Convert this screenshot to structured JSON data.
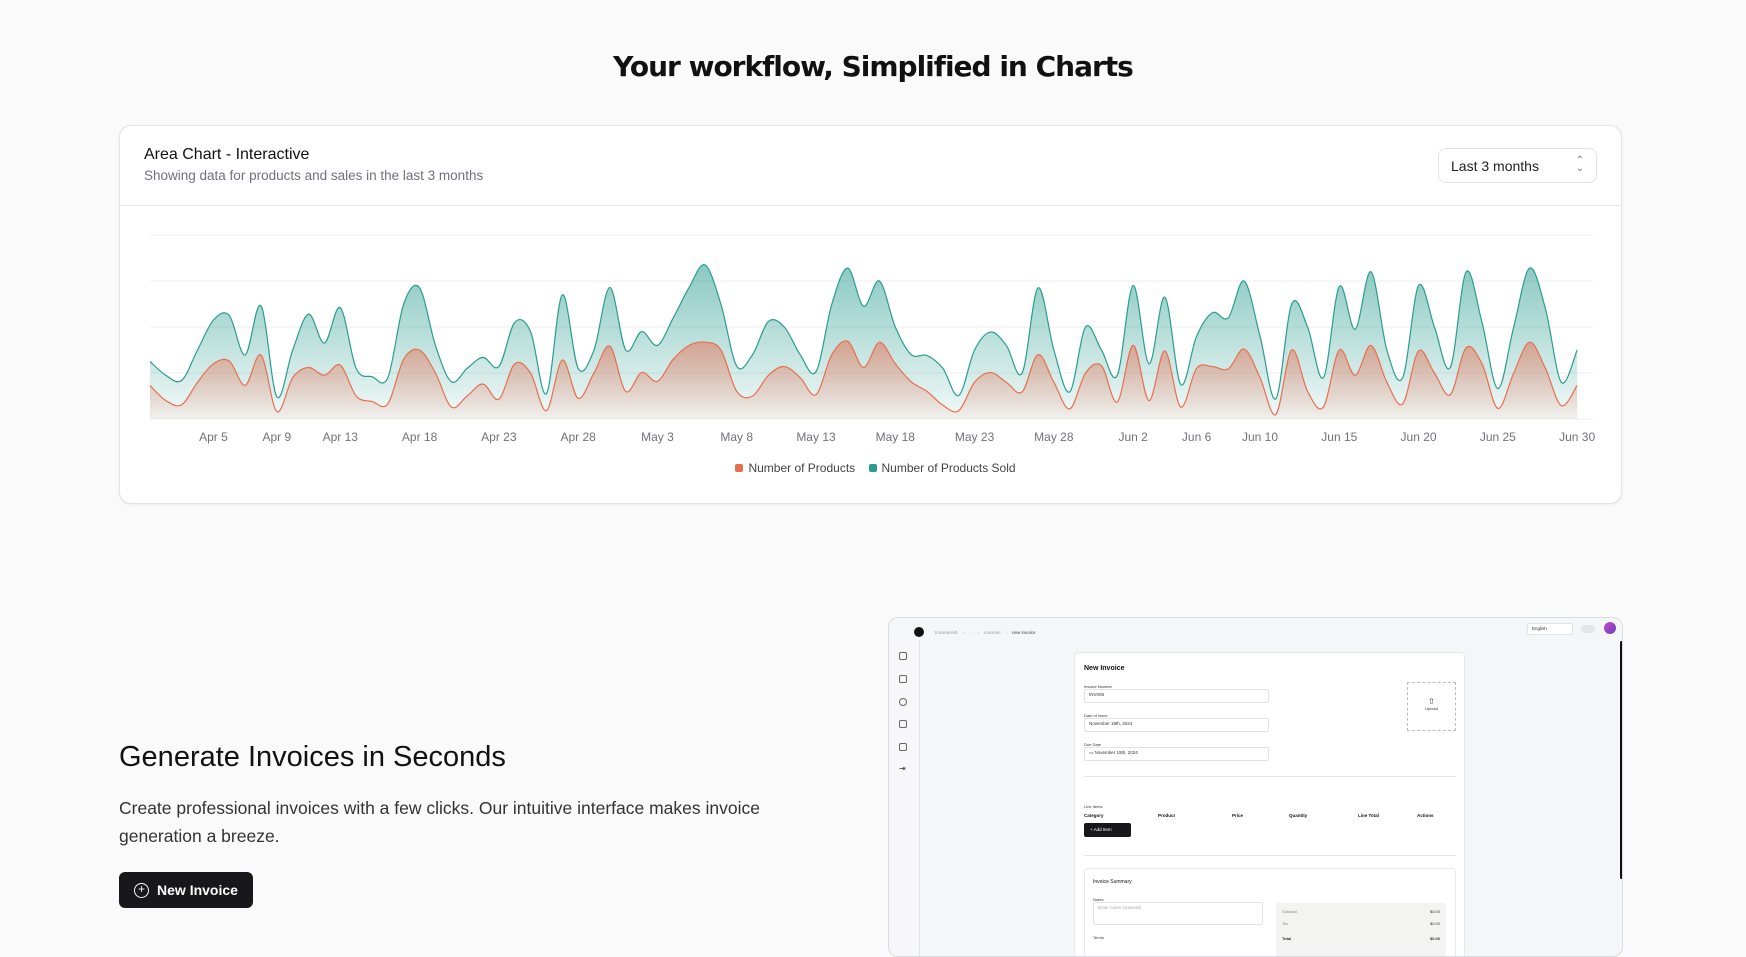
{
  "page": {
    "title": "Your workflow, Simplified in Charts"
  },
  "chart_card": {
    "title": "Area Chart - Interactive",
    "subtitle": "Showing data for products and sales in the last 3 months",
    "range_select": "Last 3 months"
  },
  "chart_data": {
    "type": "area",
    "title": "Area Chart - Interactive",
    "x_range": [
      "Apr 1",
      "Jun 30"
    ],
    "x_ticks": [
      {
        "i": 4,
        "label": "Apr 5"
      },
      {
        "i": 8,
        "label": "Apr 9"
      },
      {
        "i": 12,
        "label": "Apr 13"
      },
      {
        "i": 17,
        "label": "Apr 18"
      },
      {
        "i": 22,
        "label": "Apr 23"
      },
      {
        "i": 27,
        "label": "Apr 28"
      },
      {
        "i": 32,
        "label": "May 3"
      },
      {
        "i": 37,
        "label": "May 8"
      },
      {
        "i": 42,
        "label": "May 13"
      },
      {
        "i": 47,
        "label": "May 18"
      },
      {
        "i": 52,
        "label": "May 23"
      },
      {
        "i": 57,
        "label": "May 28"
      },
      {
        "i": 62,
        "label": "Jun 2"
      },
      {
        "i": 66,
        "label": "Jun 6"
      },
      {
        "i": 70,
        "label": "Jun 10"
      },
      {
        "i": 75,
        "label": "Jun 15"
      },
      {
        "i": 80,
        "label": "Jun 20"
      },
      {
        "i": 85,
        "label": "Jun 25"
      },
      {
        "i": 90,
        "label": "Jun 30"
      }
    ],
    "ylim": [
      0,
      400
    ],
    "grid": true,
    "legend": "bottom-center",
    "series": [
      {
        "name": "Number of Products Sold",
        "color": "#2a9d8f",
        "values": [
          125,
          95,
          84,
          150,
          215,
          225,
          139,
          246,
          48,
          150,
          228,
          165,
          242,
          110,
          92,
          90,
          250,
          285,
          160,
          81,
          110,
          134,
          114,
          210,
          190,
          55,
          270,
          110,
          150,
          286,
          150,
          190,
          160,
          220,
          286,
          335,
          250,
          115,
          140,
          212,
          200,
          140,
          103,
          250,
          328,
          245,
          300,
          200,
          140,
          138,
          110,
          51,
          150,
          189,
          160,
          100,
          285,
          150,
          59,
          200,
          150,
          95,
          290,
          120,
          265,
          75,
          180,
          231,
          220,
          300,
          180,
          44,
          250,
          200,
          90,
          288,
          195,
          320,
          150,
          90,
          290,
          200,
          112,
          320,
          210,
          66,
          200,
          328,
          240,
          80,
          150
        ]
      },
      {
        "name": "Number of Products",
        "color": "#e76f51",
        "values": [
          73,
          40,
          31,
          80,
          120,
          126,
          73,
          139,
          16,
          90,
          112,
          95,
          117,
          50,
          38,
          33,
          130,
          150,
          100,
          26,
          50,
          76,
          43,
          120,
          100,
          18,
          128,
          45,
          100,
          158,
          60,
          101,
          82,
          130,
          160,
          167,
          150,
          60,
          50,
          95,
          114,
          90,
          53,
          140,
          169,
          112,
          167,
          120,
          81,
          60,
          30,
          18,
          80,
          101,
          80,
          59,
          140,
          80,
          22,
          100,
          116,
          37,
          160,
          40,
          148,
          26,
          110,
          114,
          109,
          152,
          90,
          10,
          150,
          60,
          26,
          150,
          95,
          160,
          80,
          33,
          148,
          100,
          53,
          155,
          120,
          23,
          100,
          167,
          110,
          29,
          73
        ]
      }
    ]
  },
  "feature": {
    "title": "Generate Invoices in Seconds",
    "description": "Create professional invoices with a few clicks. Our intuitive interface makes invoice generation a breeze.",
    "button": "New Invoice"
  },
  "mock": {
    "breadcrumb": [
      "InvoiceHub",
      "...",
      "invoices",
      "new invoice"
    ],
    "language": "English",
    "form_title": "New Invoice",
    "invoice_number_label": "Invoice Number",
    "invoice_number": "INV008",
    "date_issue_label": "Date of Issue",
    "date_issue": "November 19th, 2024",
    "due_date_label": "Due Date",
    "due_date": "November 19th, 2024",
    "upload": "Upload",
    "line_items": "Line Items",
    "columns": [
      "Category",
      "Product",
      "Price",
      "Quantity",
      "Line Total",
      "Actions"
    ],
    "add_item": "Add Item",
    "summary_title": "Invoice Summary",
    "notes_label": "Notes",
    "notes_placeholder": "Enter notes (optional)",
    "terms_label": "Terms",
    "subtotal_label": "Subtotal",
    "subtotal": "$0.00",
    "tax_label": "Tax",
    "tax": "$0.00",
    "total_label": "Total",
    "total": "$0.00"
  }
}
